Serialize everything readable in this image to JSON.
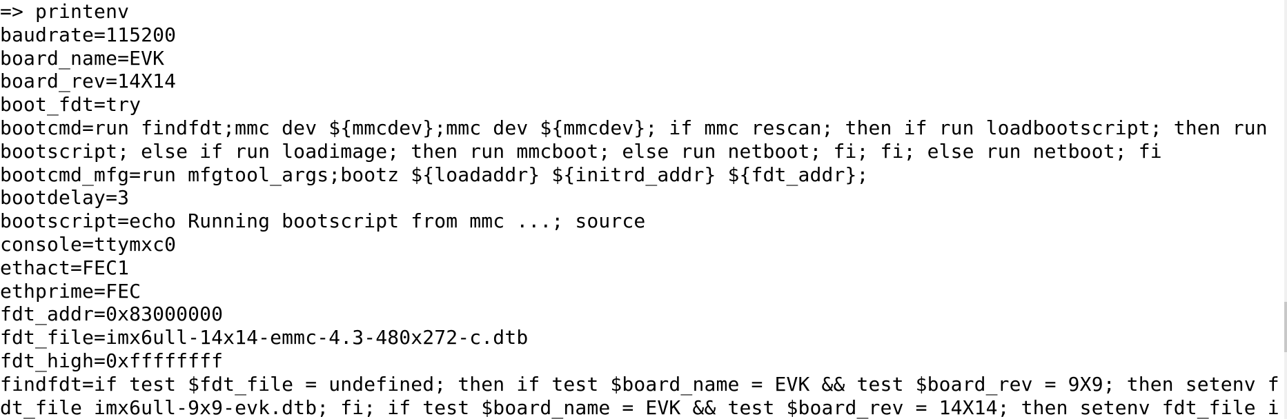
{
  "terminal": {
    "lines": [
      "=> printenv",
      "baudrate=115200",
      "board_name=EVK",
      "board_rev=14X14",
      "boot_fdt=try",
      "bootcmd=run findfdt;mmc dev ${mmcdev};mmc dev ${mmcdev}; if mmc rescan; then if run loadbootscript; then run",
      "bootscript; else if run loadimage; then run mmcboot; else run netboot; fi; fi; else run netboot; fi",
      "bootcmd_mfg=run mfgtool_args;bootz ${loadaddr} ${initrd_addr} ${fdt_addr};",
      "bootdelay=3",
      "bootscript=echo Running bootscript from mmc ...; source",
      "console=ttymxc0",
      "ethact=FEC1",
      "ethprime=FEC",
      "fdt_addr=0x83000000",
      "fdt_file=imx6ull-14x14-emmc-4.3-480x272-c.dtb",
      "fdt_high=0xffffffff",
      "findfdt=if test $fdt_file = undefined; then if test $board_name = EVK && test $board_rev = 9X9; then setenv f",
      "dt_file imx6ull-9x9-evk.dtb; fi; if test $board_name = EVK && test $board_rev = 14X14; then setenv fdt_file i"
    ]
  },
  "scrollbar": {
    "thumb_start_fraction": 0.72,
    "thumb_end_fraction": 0.84
  }
}
